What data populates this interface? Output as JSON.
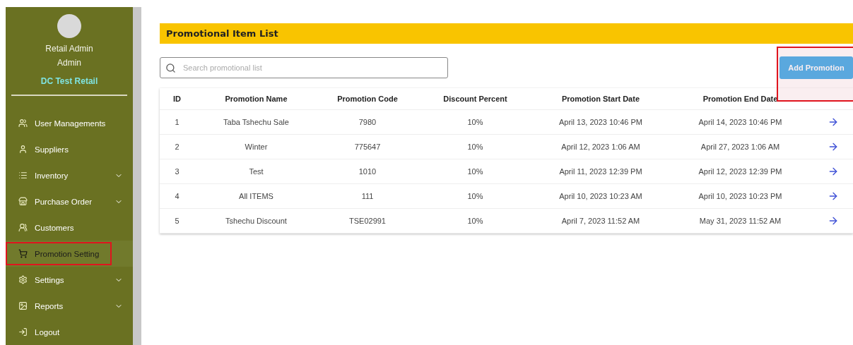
{
  "sidebar": {
    "user": {
      "name": "Retail Admin",
      "role": "Admin",
      "company": "DC Test Retail"
    },
    "items": [
      {
        "label": "User Managements",
        "expandable": false,
        "selected": false,
        "highlighted": false
      },
      {
        "label": "Suppliers",
        "expandable": false,
        "selected": false,
        "highlighted": false
      },
      {
        "label": "Inventory",
        "expandable": true,
        "selected": false,
        "highlighted": false
      },
      {
        "label": "Purchase Order",
        "expandable": true,
        "selected": false,
        "highlighted": false
      },
      {
        "label": "Customers",
        "expandable": false,
        "selected": false,
        "highlighted": false
      },
      {
        "label": "Promotion Setting",
        "expandable": false,
        "selected": true,
        "highlighted": true
      },
      {
        "label": "Settings",
        "expandable": true,
        "selected": false,
        "highlighted": false
      },
      {
        "label": "Reports",
        "expandable": true,
        "selected": false,
        "highlighted": false
      },
      {
        "label": "Logout",
        "expandable": false,
        "selected": false,
        "highlighted": false
      }
    ]
  },
  "header": {
    "title": "Promotional Item List"
  },
  "search": {
    "placeholder": "Search promotional list"
  },
  "add_button": {
    "label": "Add Promotion",
    "highlighted": true
  },
  "table": {
    "columns": [
      "ID",
      "Promotion Name",
      "Promotion Code",
      "Discount Percent",
      "Promotion Start Date",
      "Promotion End Date"
    ],
    "rows": [
      [
        "1",
        "Taba Tshechu Sale",
        "7980",
        "10%",
        "April 13, 2023 10:46 PM",
        "April 14, 2023 10:46 PM"
      ],
      [
        "2",
        "Winter",
        "775647",
        "10%",
        "April 12, 2023 1:06 AM",
        "April 27, 2023 1:06 AM"
      ],
      [
        "3",
        "Test",
        "1010",
        "10%",
        "April 11, 2023 12:39 PM",
        "April 12, 2023 12:39 PM"
      ],
      [
        "4",
        "All ITEMS",
        "111",
        "10%",
        "April 10, 2023 10:23 AM",
        "April 10, 2023 10:23 PM"
      ],
      [
        "5",
        "Tshechu Discount",
        "TSE02991",
        "10%",
        "April 7, 2023 11:52 AM",
        "May 31, 2023 11:52 AM"
      ]
    ]
  }
}
